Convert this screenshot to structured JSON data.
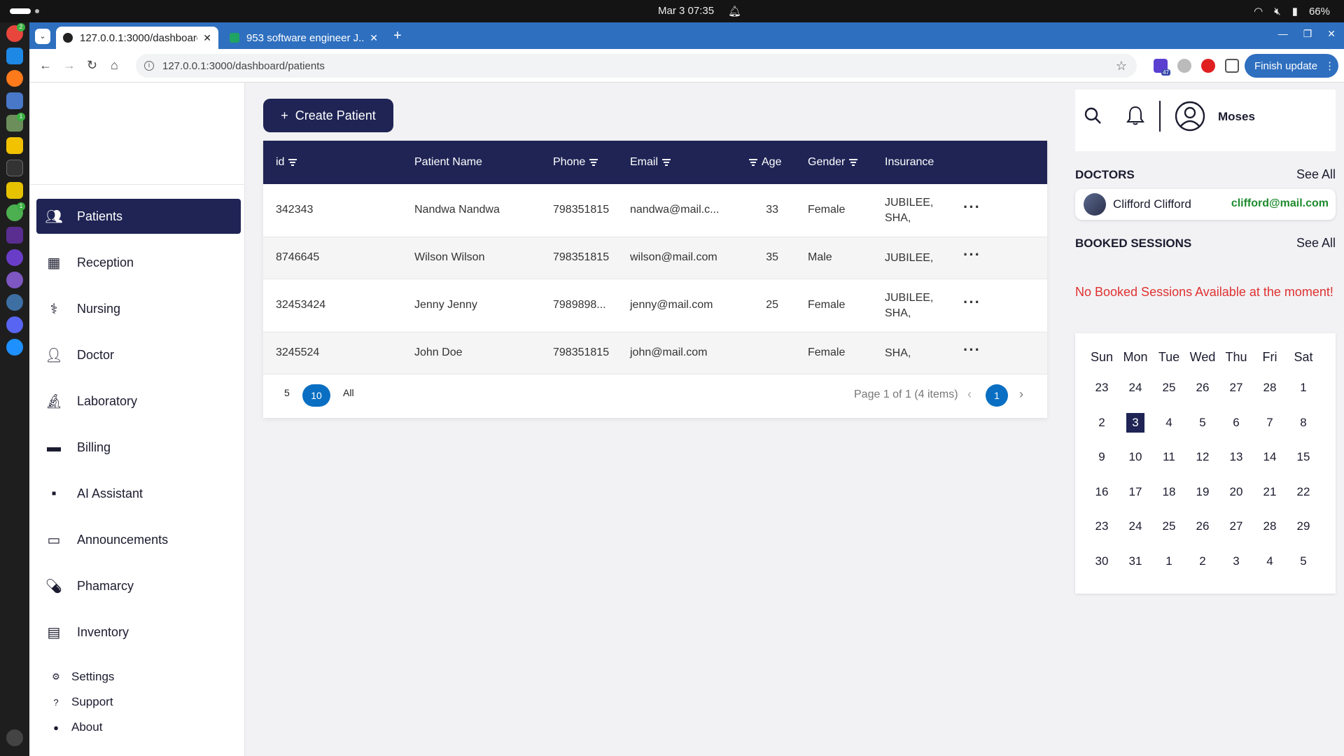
{
  "os": {
    "clock": "Mar 3  07:35",
    "battery": "66%"
  },
  "browser": {
    "tabs": [
      {
        "title": "127.0.0.1:3000/dashboard"
      },
      {
        "title": "953 software engineer J..."
      }
    ],
    "url": "127.0.0.1:3000/dashboard/patients",
    "finish_update": "Finish update",
    "ext_badge": "47"
  },
  "sidebar": {
    "items": [
      {
        "label": "Patients",
        "icon": "users-icon"
      },
      {
        "label": "Reception",
        "icon": "grid-icon"
      },
      {
        "label": "Nursing",
        "icon": "nurse-icon"
      },
      {
        "label": "Doctor",
        "icon": "doctor-icon"
      },
      {
        "label": "Laboratory",
        "icon": "microscope-icon"
      },
      {
        "label": "Billing",
        "icon": "money-icon"
      },
      {
        "label": "AI Assistant",
        "icon": "chat-icon"
      },
      {
        "label": "Announcements",
        "icon": "calendar-icon"
      },
      {
        "label": "Phamarcy",
        "icon": "pill-icon"
      },
      {
        "label": "Inventory",
        "icon": "archive-icon"
      }
    ],
    "footer": [
      {
        "label": "Settings",
        "icon": "gear-icon"
      },
      {
        "label": "Support",
        "icon": "help-icon"
      },
      {
        "label": "About",
        "icon": "info-icon"
      }
    ]
  },
  "main": {
    "create_button": "Create Patient",
    "columns": [
      "id",
      "Patient Name",
      "Phone",
      "Email",
      "Age",
      "Gender",
      "Insurance"
    ],
    "rows": [
      {
        "id": "342343",
        "name": "Nandwa Nandwa",
        "phone": "798351815",
        "email": "nandwa@mail.c...",
        "age": "33",
        "gender": "Female",
        "insurance": [
          "JUBILEE,",
          "SHA,"
        ]
      },
      {
        "id": "8746645",
        "name": "Wilson Wilson",
        "phone": "798351815",
        "email": "wilson@mail.com",
        "age": "35",
        "gender": "Male",
        "insurance": [
          "JUBILEE,"
        ]
      },
      {
        "id": "32453424",
        "name": "Jenny Jenny",
        "phone": "7989898...",
        "email": "jenny@mail.com",
        "age": "25",
        "gender": "Female",
        "insurance": [
          "JUBILEE,",
          "SHA,"
        ]
      },
      {
        "id": "3245524",
        "name": "John Doe",
        "phone": "798351815",
        "email": "john@mail.com",
        "age": "",
        "gender": "Female",
        "insurance": [
          "SHA,"
        ]
      }
    ],
    "page_sizes": [
      "5",
      "10",
      "All"
    ],
    "page_info": "Page 1 of 1 (4 items)",
    "current_page": "1"
  },
  "right": {
    "user_name": "Moses",
    "doctors_title": "DOCTORS",
    "see_all": "See All",
    "doctor": {
      "name": "Clifford Clifford",
      "email": "clifford@mail.com"
    },
    "sessions_title": "BOOKED SESSIONS",
    "no_sessions": "No Booked Sessions Available at the moment!",
    "calendar": {
      "weekdays": [
        "Sun",
        "Mon",
        "Tue",
        "Wed",
        "Thu",
        "Fri",
        "Sat"
      ],
      "weeks": [
        [
          "23",
          "24",
          "25",
          "26",
          "27",
          "28",
          "1"
        ],
        [
          "2",
          "3",
          "4",
          "5",
          "6",
          "7",
          "8"
        ],
        [
          "9",
          "10",
          "11",
          "12",
          "13",
          "14",
          "15"
        ],
        [
          "16",
          "17",
          "18",
          "19",
          "20",
          "21",
          "22"
        ],
        [
          "23",
          "24",
          "25",
          "26",
          "27",
          "28",
          "29"
        ],
        [
          "30",
          "31",
          "1",
          "2",
          "3",
          "4",
          "5"
        ]
      ],
      "today": "3"
    }
  },
  "colors": {
    "primary": "#1f2455",
    "accent": "#0a6fc2",
    "success": "#1e8b2e",
    "danger": "#e03131"
  }
}
